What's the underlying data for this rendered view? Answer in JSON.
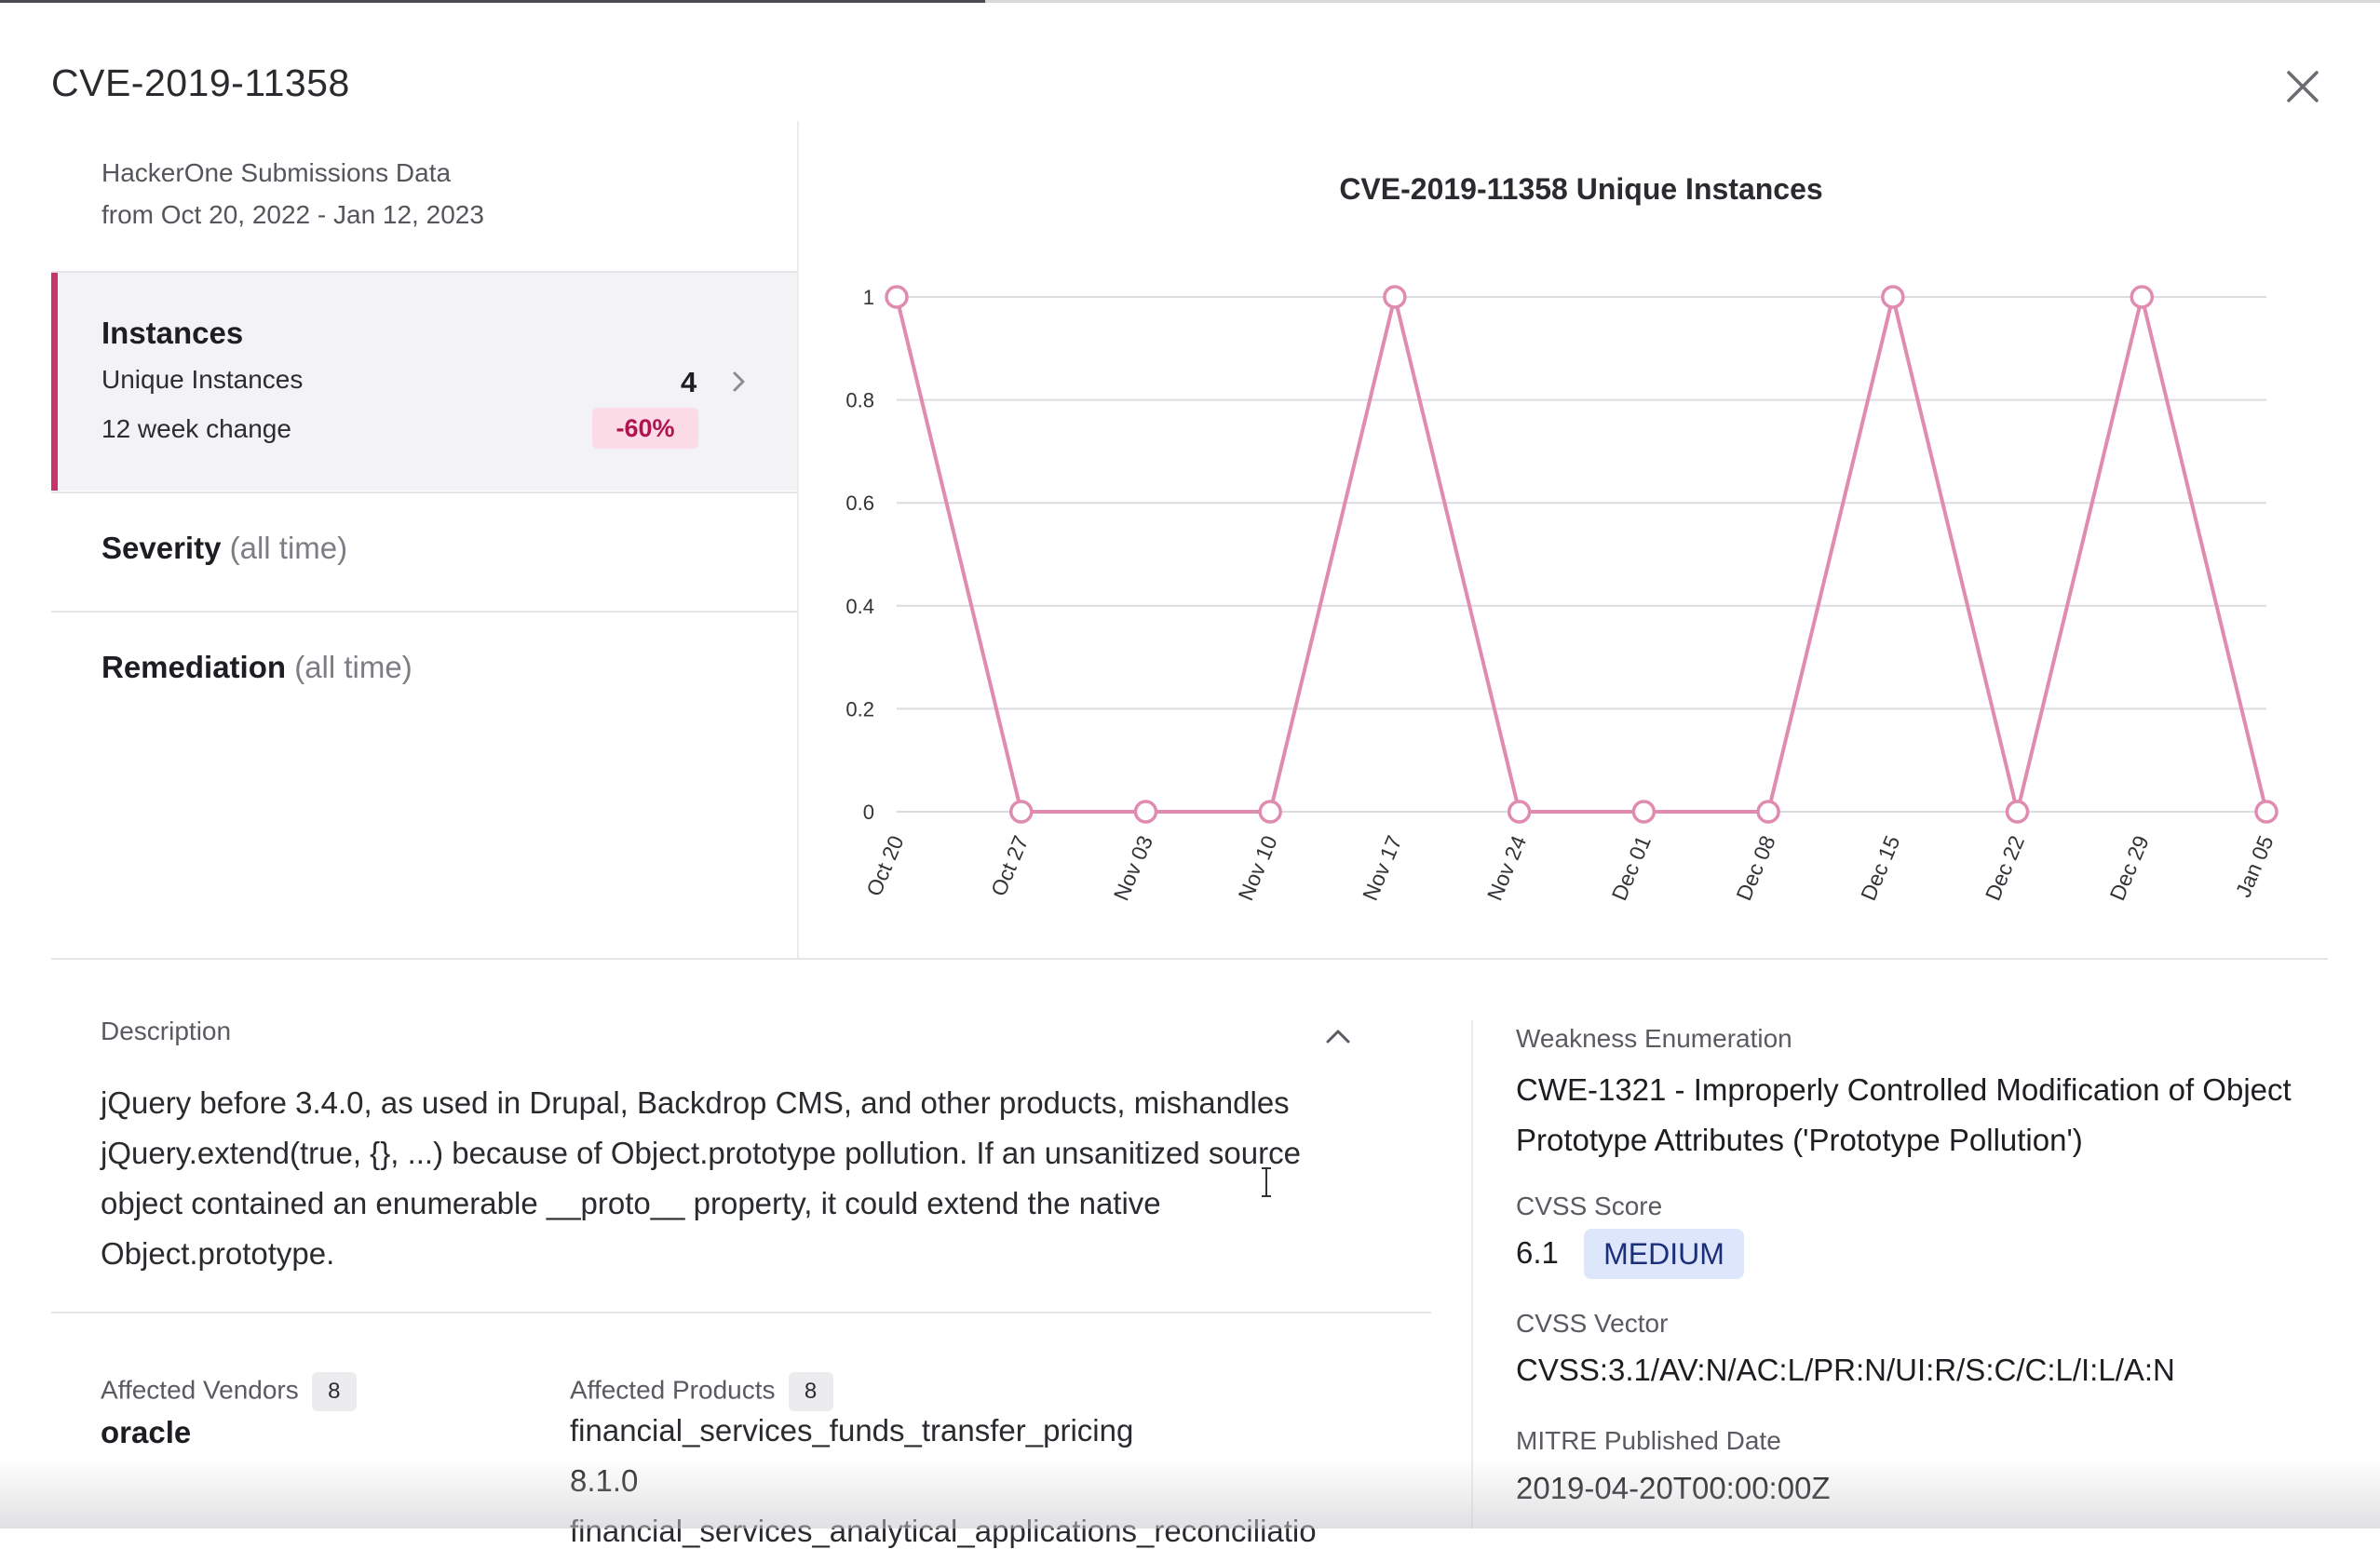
{
  "modal": {
    "title": "CVE-2019-11358"
  },
  "summary": {
    "source_line": "HackerOne Submissions Data",
    "range_line": "from Oct 20, 2022 - Jan 12, 2023",
    "instances": {
      "title": "Instances",
      "unique_label": "Unique Instances",
      "unique_count": "4",
      "change_label": "12 week change",
      "change_value": "-60%"
    },
    "severity": {
      "title": "Severity",
      "sub": "(all time)"
    },
    "remediation": {
      "title": "Remediation",
      "sub": "(all time)"
    }
  },
  "chart_data": {
    "type": "line",
    "title": "CVE-2019-11358 Unique Instances",
    "categories": [
      "Oct 20",
      "Oct 27",
      "Nov 03",
      "Nov 10",
      "Nov 17",
      "Nov 24",
      "Dec 01",
      "Dec 08",
      "Dec 15",
      "Dec 22",
      "Dec 29",
      "Jan 05"
    ],
    "series": [
      {
        "values": [
          1,
          0,
          0,
          0,
          1,
          0,
          0,
          0,
          1,
          0,
          1,
          0
        ]
      }
    ],
    "y_ticks": [
      "0",
      "0.2",
      "0.4",
      "0.6",
      "0.8",
      "1"
    ],
    "ylim": [
      0,
      1
    ],
    "grid": true,
    "legend": "none",
    "color": "#e08bb0"
  },
  "description": {
    "label": "Description",
    "text": "jQuery before 3.4.0, as used in Drupal, Backdrop CMS, and other products, mishandles jQuery.extend(true, {}, ...) because of Object.prototype pollution. If an unsanitized source object contained an enumerable __proto__ property, it could extend the native Object.prototype."
  },
  "affected": {
    "vendors_label": "Affected Vendors",
    "vendors_count": "8",
    "vendor_first": "oracle",
    "products_label": "Affected Products",
    "products_count": "8",
    "product_first": "financial_services_funds_transfer_pricing",
    "product_first_version": "8.1.0",
    "product_second_partial": "financial_services_analytical_applications_reconciliatio"
  },
  "details": {
    "weakness_label": "Weakness Enumeration",
    "weakness_value": "CWE-1321 - Improperly Controlled Modification of Object Prototype Attributes ('Prototype Pollution')",
    "cvss_score_label": "CVSS Score",
    "cvss_score": "6.1",
    "cvss_severity": "MEDIUM",
    "cvss_vector_label": "CVSS Vector",
    "cvss_vector": "CVSS:3.1/AV:N/AC:L/PR:N/UI:R/S:C/C:L/I:L/A:N",
    "mitre_label": "MITRE Published Date",
    "mitre_date": "2019-04-20T00:00:00Z"
  },
  "icons": {
    "close": "close-icon",
    "chevron_right": "chevron-right-icon",
    "chevron_up": "chevron-up-icon",
    "text_cursor": "text-cursor-icon"
  }
}
